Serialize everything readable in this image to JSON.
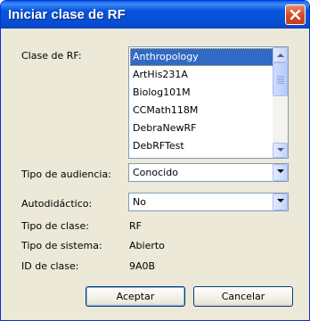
{
  "window": {
    "title": "Iniciar clase de RF"
  },
  "form": {
    "class_label": "Clase de RF:",
    "classes": [
      "Anthropology",
      "ArtHis231A",
      "Biolog101M",
      "CCMath118M",
      "DebraNewRF",
      "DebRFTest"
    ],
    "selected_class_index": 0,
    "audience_label": "Tipo de audiencia:",
    "audience_value": "Conocido",
    "selfpaced_label": "Autodidáctico:",
    "selfpaced_value": "No",
    "class_type_label": "Tipo de clase:",
    "class_type_value": "RF",
    "system_type_label": "Tipo de sistema:",
    "system_type_value": "Abierto",
    "class_id_label": "ID de clase:",
    "class_id_value": "9A0B"
  },
  "buttons": {
    "accept": "Aceptar",
    "cancel": "Cancelar"
  },
  "icons": {
    "close": "close-icon",
    "scroll_up": "chevron-up-icon",
    "scroll_down": "chevron-down-icon",
    "dropdown": "chevron-down-icon"
  },
  "colors": {
    "titlebar": "#0855dd",
    "close_button": "#d24a25",
    "dialog_background": "#ece9d8",
    "selection": "#316ac5"
  }
}
